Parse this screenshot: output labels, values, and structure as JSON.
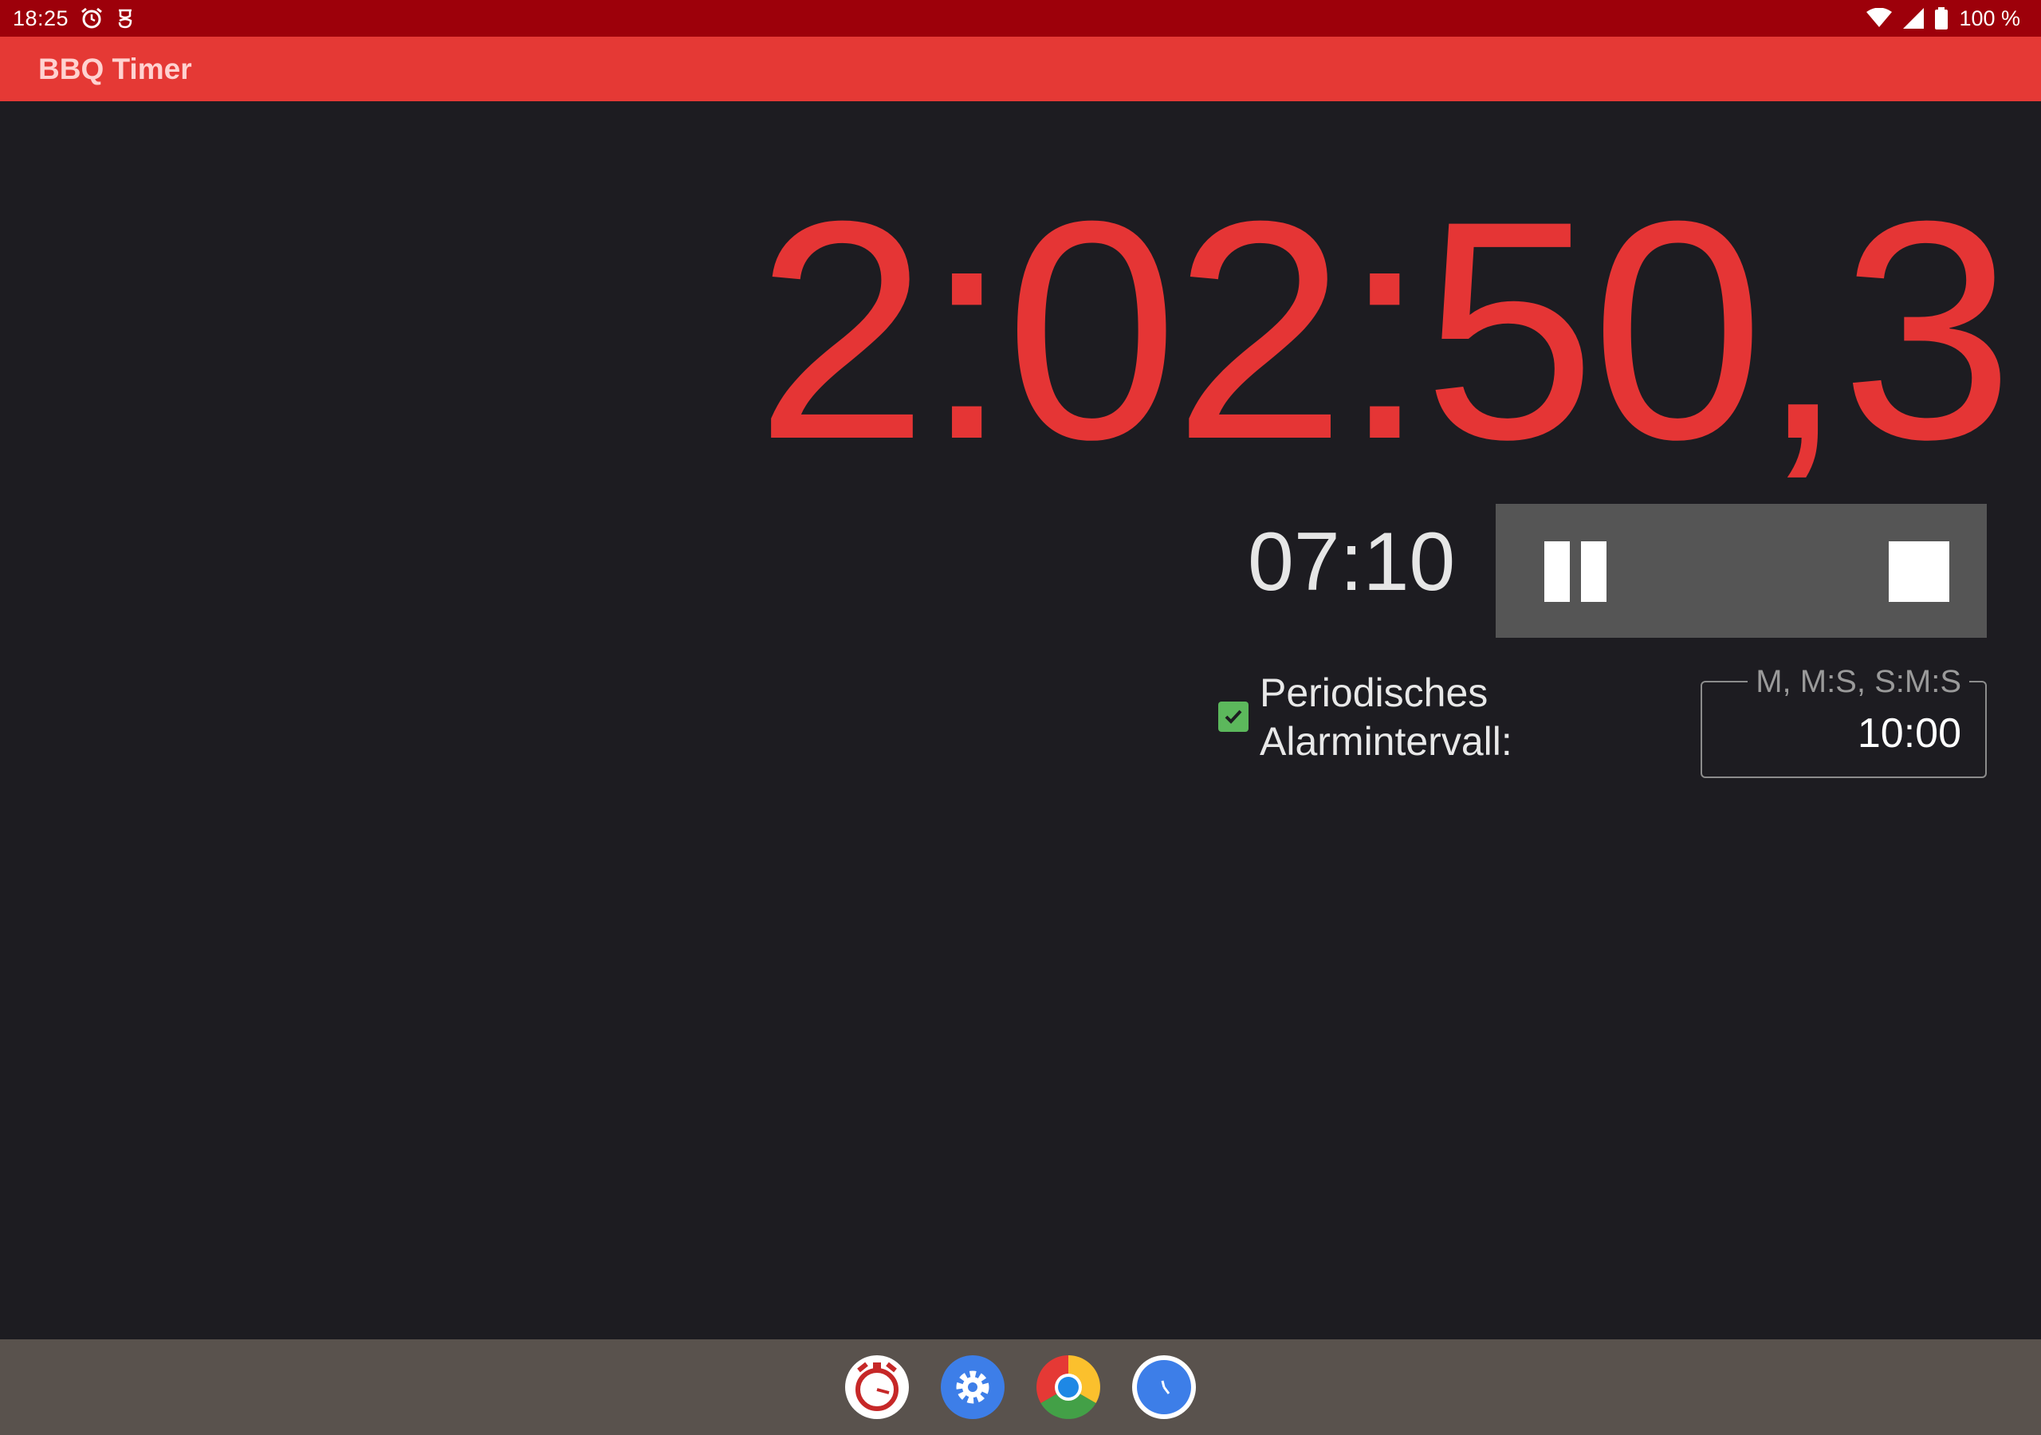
{
  "status_bar": {
    "time": "18:25",
    "battery": "100 %",
    "icons": [
      "alarm-clock-icon",
      "notification-icon",
      "wifi-icon",
      "signal-icon",
      "battery-icon"
    ]
  },
  "app_bar": {
    "title": "BBQ Timer"
  },
  "timer": {
    "elapsed": "2:02:50,3",
    "countdown": "07:10"
  },
  "controls": {
    "pause_icon": "pause-icon",
    "stop_icon": "stop-icon"
  },
  "periodic_alarm": {
    "checked": true,
    "label_line1": "Periodisches",
    "label_line2": "Alarmintervall:",
    "field_hint": "M, M:S, S:M:S",
    "field_value": "10:00"
  },
  "taskbar": {
    "apps": [
      "bbq-timer-app-icon",
      "settings-app-icon",
      "chrome-app-icon",
      "clock-app-icon"
    ]
  },
  "colors": {
    "status_bar": "#9d000a",
    "app_bar": "#e53935",
    "background": "#1d1c21",
    "elapsed_text": "#e53535",
    "control_panel": "#555555",
    "checkbox": "#5cb85c",
    "taskbar": "#59524d"
  }
}
